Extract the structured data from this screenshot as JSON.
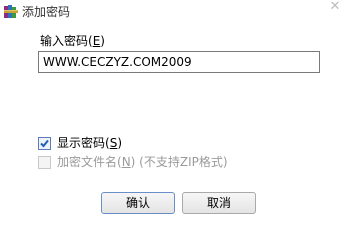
{
  "window": {
    "title": "添加密码",
    "app_icon": "winrar-books-icon",
    "close_glyph": "✕"
  },
  "password": {
    "label_main": "输入密码(",
    "label_key": "E",
    "label_end": ")",
    "value": "WWW.CECZYZ.COM2009"
  },
  "options": {
    "show_password": {
      "label_main": "显示密码(",
      "label_key": "S",
      "label_end": ")",
      "checked": true,
      "enabled": true
    },
    "encrypt_filenames": {
      "label_main": "加密文件名(",
      "label_key": "N",
      "label_end": ")",
      "note": " (不支持ZIP格式)",
      "checked": false,
      "enabled": false
    }
  },
  "buttons": {
    "ok_label": "确认",
    "cancel_label": "取消"
  },
  "colors": {
    "check_mark": "#1f5fb8",
    "disabled_text": "#9a9a9a"
  }
}
